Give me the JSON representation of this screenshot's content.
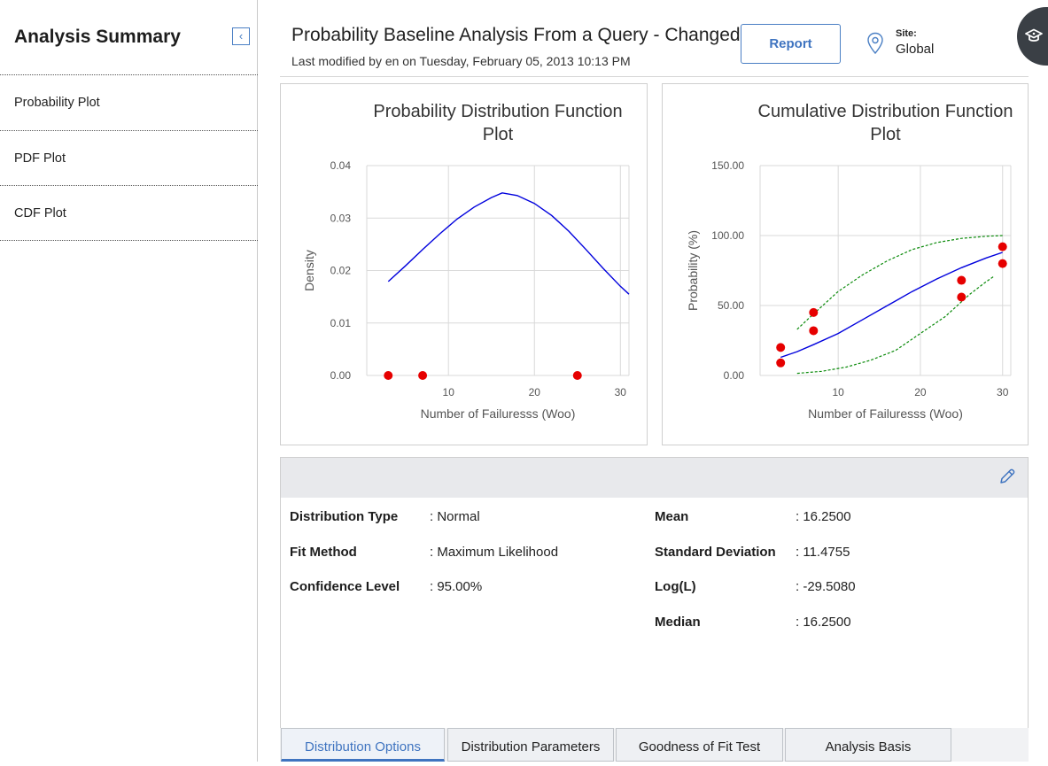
{
  "sidebar": {
    "title": "Analysis Summary",
    "collapse_icon": "chevron-left-icon",
    "items": [
      {
        "label": "Probability Plot"
      },
      {
        "label": "PDF Plot"
      },
      {
        "label": "CDF Plot"
      }
    ]
  },
  "header": {
    "title": "Probability Baseline Analysis From a Query - Changed",
    "subtitle": "Last modified by en on Tuesday, February 05, 2013 10:13 PM",
    "report_label": "Report",
    "site_label": "Site:",
    "site_value": "Global"
  },
  "colors": {
    "accent": "#3f74c0",
    "curve": "#0000dd",
    "confidence": "#0a8a0a",
    "points": "#e60000"
  },
  "chart_data": [
    {
      "type": "line",
      "title": "Probability Distribution Function Plot",
      "xlabel": "Number of Failuresss (Woo)",
      "ylabel": "Density",
      "xlim": [
        0.5,
        31
      ],
      "ylim": [
        0,
        0.04
      ],
      "xticks": [
        10,
        20,
        30
      ],
      "yticks": [
        0,
        0.01,
        0.02,
        0.03,
        0.04
      ],
      "ytick_labels": [
        "0.00",
        "0.01",
        "0.02",
        "0.03",
        "0.04"
      ],
      "grid": true,
      "series": [
        {
          "kind": "curve",
          "x": [
            3,
            5,
            7,
            9,
            11,
            13,
            15,
            16.25,
            18,
            20,
            22,
            24,
            26,
            28,
            30,
            31
          ],
          "y": [
            0.0179,
            0.0209,
            0.024,
            0.027,
            0.0298,
            0.0321,
            0.0339,
            0.0348,
            0.0343,
            0.0328,
            0.0305,
            0.0275,
            0.024,
            0.0204,
            0.017,
            0.0155
          ]
        },
        {
          "kind": "points",
          "x": [
            3,
            7,
            25
          ],
          "y": [
            0,
            0,
            0
          ]
        }
      ]
    },
    {
      "type": "line",
      "title": "Cumulative Distribution Function Plot",
      "xlabel": "Number of Failuresss (Woo)",
      "ylabel": "Probability (%)",
      "xlim": [
        0.5,
        31
      ],
      "ylim": [
        0,
        150
      ],
      "xticks": [
        10,
        20,
        30
      ],
      "yticks": [
        0,
        50,
        100,
        150
      ],
      "ytick_labels": [
        "0.00",
        "50.00",
        "100.00",
        "150.00"
      ],
      "grid": true,
      "series": [
        {
          "kind": "fit",
          "x": [
            3,
            5,
            7,
            10,
            13,
            16,
            19,
            22,
            25,
            28,
            30
          ],
          "y": [
            13,
            17,
            22,
            30,
            40,
            50,
            60,
            69,
            77,
            84,
            88
          ]
        },
        {
          "kind": "upper",
          "x": [
            5,
            7,
            10,
            13,
            16,
            19,
            22,
            25,
            28,
            30
          ],
          "y": [
            33,
            44,
            60,
            72,
            82,
            90,
            95,
            98,
            99.5,
            100
          ]
        },
        {
          "kind": "lower",
          "x": [
            5,
            8,
            11,
            14,
            17,
            20,
            23,
            26,
            28,
            29
          ],
          "y": [
            1.5,
            3,
            6,
            11,
            18,
            30,
            42,
            58,
            67,
            71
          ]
        },
        {
          "kind": "points",
          "x": [
            3,
            3,
            7,
            7,
            25,
            25,
            30,
            30
          ],
          "y": [
            9,
            20,
            32,
            45,
            56,
            68,
            80,
            92
          ]
        }
      ]
    }
  ],
  "details": {
    "edit_icon": "pencil-icon",
    "rows_left": [
      {
        "label": "Distribution Type",
        "value": ": Normal"
      },
      {
        "label": "Fit Method",
        "value": ": Maximum Likelihood"
      },
      {
        "label": "Confidence Level",
        "value": ": 95.00%"
      }
    ],
    "rows_right": [
      {
        "label": "Mean",
        "value": ": 16.2500"
      },
      {
        "label": "Standard Deviation",
        "value": ": 11.4755"
      },
      {
        "label": "Log(L)",
        "value": ": -29.5080"
      },
      {
        "label": "Median",
        "value": ": 16.2500"
      }
    ]
  },
  "tabs": [
    {
      "label": "Distribution Options",
      "active": true
    },
    {
      "label": "Distribution Parameters",
      "active": false
    },
    {
      "label": "Goodness of Fit Test",
      "active": false
    },
    {
      "label": "Analysis Basis",
      "active": false
    }
  ]
}
